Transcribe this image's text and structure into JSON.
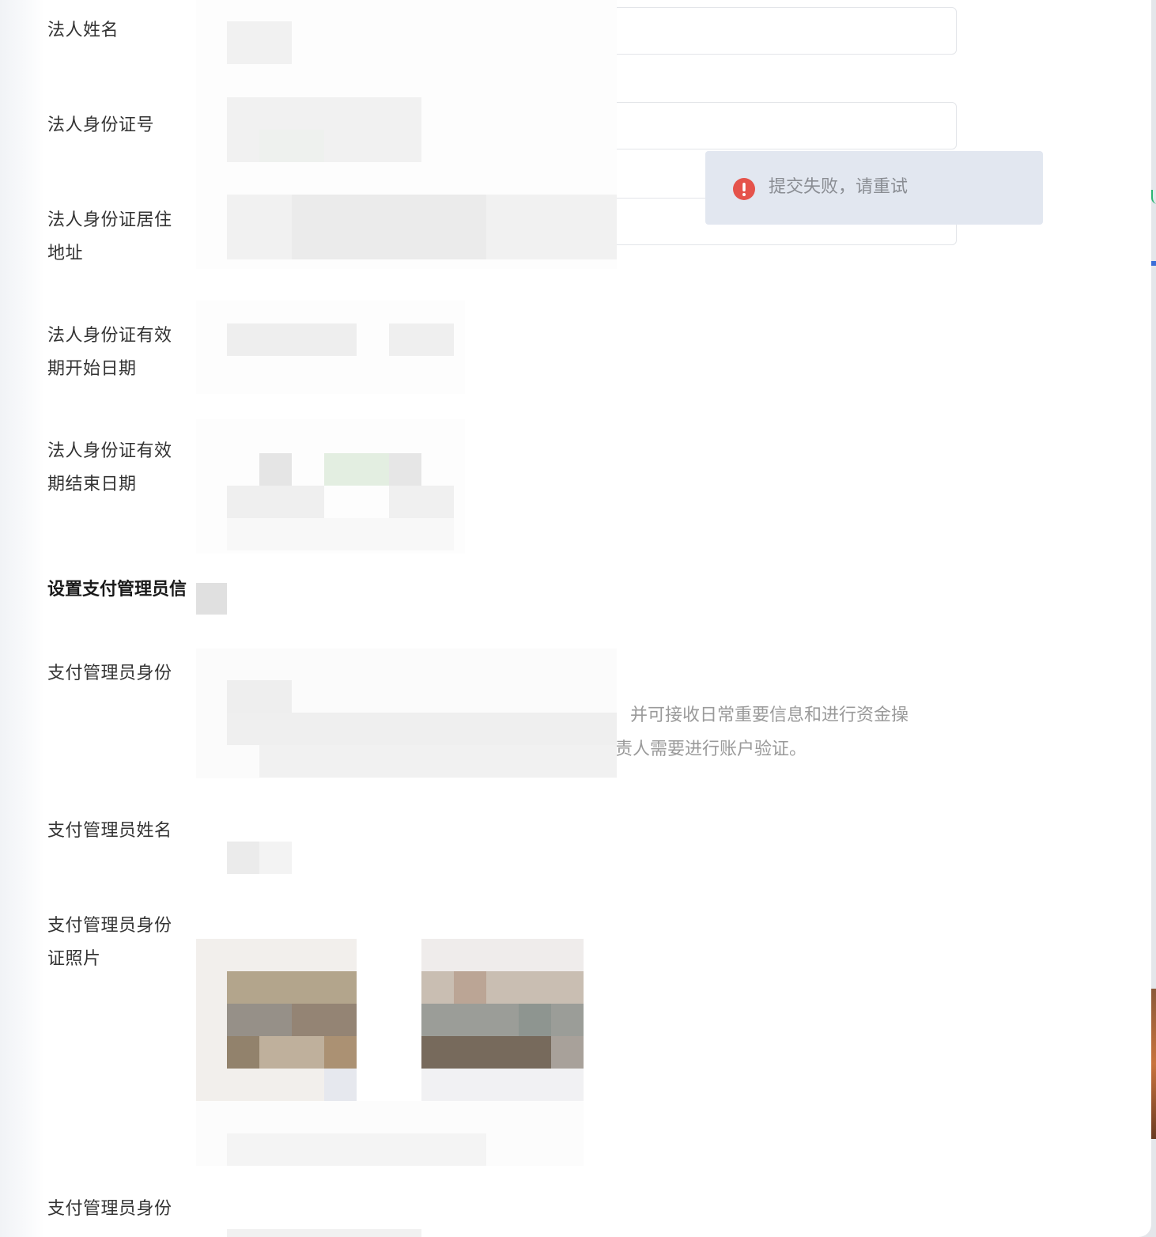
{
  "form": {
    "fields": [
      {
        "label": "法人姓名"
      },
      {
        "label": "法人身份证号"
      },
      {
        "label_line1": "法人身份证居住",
        "label_line2": "地址"
      },
      {
        "label_line1": "法人身份证有效",
        "label_line2": "期开始日期"
      },
      {
        "label_line1": "法人身份证有效",
        "label_line2": "期结束日期"
      }
    ],
    "section_title": "设置支付管理员信",
    "admin_fields": [
      {
        "label": "支付管理员身份"
      },
      {
        "label": "支付管理员姓名"
      },
      {
        "label_line1": "支付管理员身份",
        "label_line2": "证照片"
      },
      {
        "label": "支付管理员身份"
      }
    ],
    "admin_description": {
      "line1": "并可接收日常重要信息和进行资金操",
      "line2": "责人需要进行账户验证。"
    }
  },
  "toast": {
    "type": "error",
    "icon": "exclamation-circle-icon",
    "message": "提交失败，请重试",
    "icon_color": "#e5534b"
  }
}
